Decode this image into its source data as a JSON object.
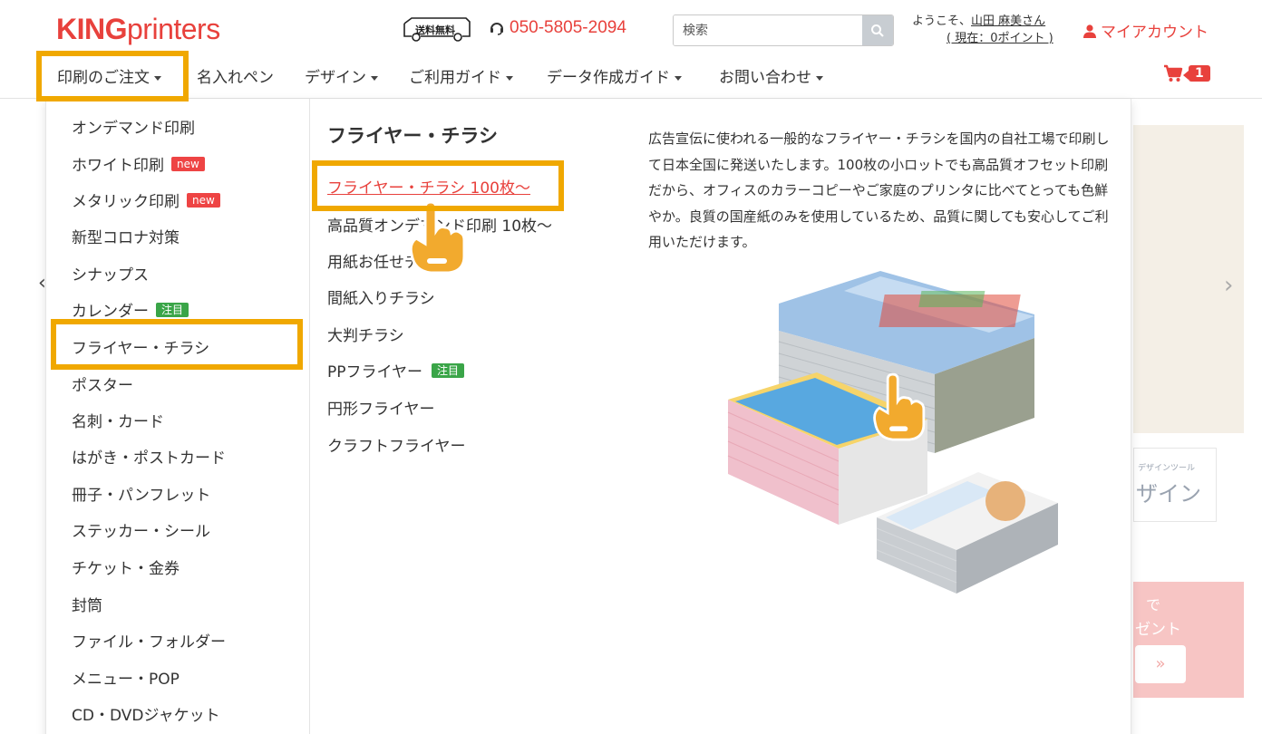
{
  "header": {
    "logo_bold": "KING",
    "logo_rest": "printers",
    "shipping_badge": "送料無料",
    "phone": "050-5805-2094",
    "search_placeholder": "検索",
    "welcome_prefix": "ようこそ、",
    "user_name": "山田 麻美さん",
    "points": "( 現在：0ポイント )",
    "account_label": "マイアカウント",
    "cart_count": "1"
  },
  "nav": {
    "items": [
      {
        "label": "印刷のご注文",
        "caret": true
      },
      {
        "label": "名入れペン",
        "caret": false
      },
      {
        "label": "デザイン",
        "caret": true
      },
      {
        "label": "ご利用ガイド",
        "caret": true
      },
      {
        "label": "データ作成ガイド",
        "caret": true
      },
      {
        "label": "お問い合わせ",
        "caret": true
      }
    ]
  },
  "menu": {
    "categories": [
      {
        "label": "オンデマンド印刷",
        "tag": ""
      },
      {
        "label": "ホワイト印刷",
        "tag": "new"
      },
      {
        "label": "メタリック印刷",
        "tag": "new"
      },
      {
        "label": "新型コロナ対策",
        "tag": ""
      },
      {
        "label": "シナップス",
        "tag": ""
      },
      {
        "label": "カレンダー",
        "tag": "注目"
      },
      {
        "label": "フライヤー・チラシ",
        "tag": ""
      },
      {
        "label": "ポスター",
        "tag": ""
      },
      {
        "label": "名刺・カード",
        "tag": ""
      },
      {
        "label": "はがき・ポストカード",
        "tag": ""
      },
      {
        "label": "冊子・パンフレット",
        "tag": ""
      },
      {
        "label": "ステッカー・シール",
        "tag": ""
      },
      {
        "label": "チケット・金券",
        "tag": ""
      },
      {
        "label": "封筒",
        "tag": ""
      },
      {
        "label": "ファイル・フォルダー",
        "tag": ""
      },
      {
        "label": "メニュー・POP",
        "tag": ""
      },
      {
        "label": "CD・DVDジャケット",
        "tag": ""
      }
    ],
    "section_title": "フライヤー・チラシ",
    "subitems": [
      {
        "label": "フライヤー・チラシ 100枚〜",
        "tag": ""
      },
      {
        "label": "高品質オンデマンド印刷 10枚〜",
        "tag": ""
      },
      {
        "label": "用紙お任せチラシ",
        "tag": ""
      },
      {
        "label": "間紙入りチラシ",
        "tag": ""
      },
      {
        "label": "大判チラシ",
        "tag": ""
      },
      {
        "label": "PPフライヤー",
        "tag": "注目"
      },
      {
        "label": "円形フライヤー",
        "tag": ""
      },
      {
        "label": "クラフトフライヤー",
        "tag": ""
      }
    ],
    "description": "広告宣伝に使われる一般的なフライヤー・チラシを国内の自社工場で印刷して日本全国に発送いたします。100枚の小ロットでも高品質オフセット印刷だから、オフィスのカラーコピーやご家庭のプリンタに比べてとっても色鮮やか。良質の国産紙のみを使用しているため、品質に関しても安心してご利用いただけます。"
  },
  "background": {
    "design_small": "デザインツール",
    "design_large": "ザイン",
    "promo_line1": "で",
    "promo_line2": "ゼント",
    "promo_button": "»"
  },
  "colors": {
    "brand": "#e8413c",
    "highlight": "#f0a800",
    "tag_new": "#ee4444",
    "tag_featured": "#3aa548"
  }
}
